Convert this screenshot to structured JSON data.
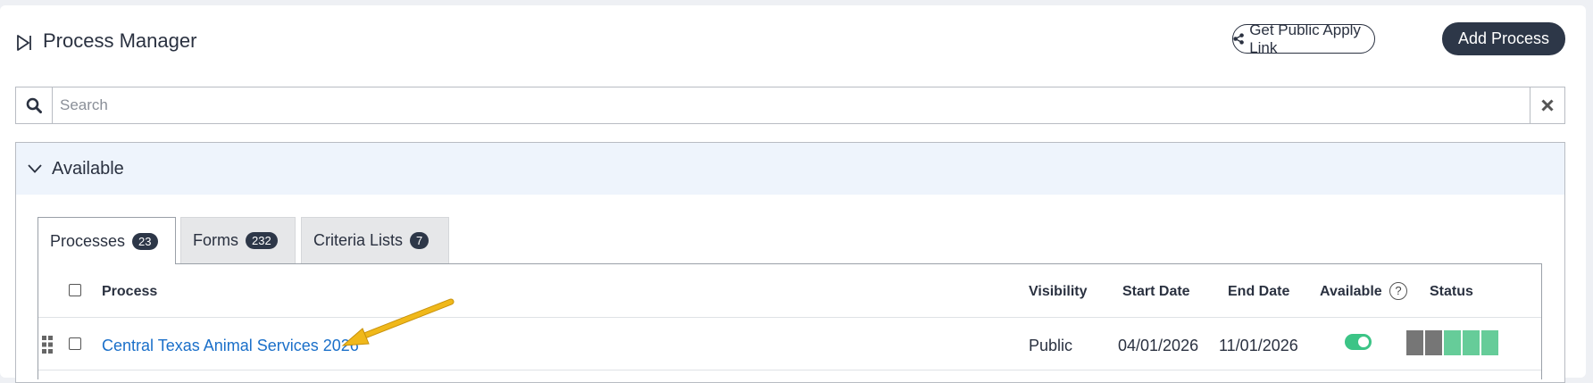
{
  "header": {
    "title": "Process Manager",
    "public_link_label": "Get Public Apply Link",
    "add_process_label": "Add Process"
  },
  "search": {
    "placeholder": "Search",
    "value": ""
  },
  "panel": {
    "title": "Available",
    "expanded": true
  },
  "tabs": [
    {
      "label": "Processes",
      "count": "23",
      "active": true
    },
    {
      "label": "Forms",
      "count": "232",
      "active": false
    },
    {
      "label": "Criteria Lists",
      "count": "7",
      "active": false
    }
  ],
  "table": {
    "columns": [
      "Process",
      "Visibility",
      "Start Date",
      "End Date",
      "Available",
      "Status"
    ],
    "rows": [
      {
        "process": "Central Texas Animal Services 2026",
        "visibility": "Public",
        "start_date": "04/01/2026",
        "end_date": "11/01/2026",
        "available": true,
        "status_segments": [
          "gray",
          "gray",
          "green",
          "green",
          "green"
        ]
      }
    ]
  },
  "colors": {
    "primary_dark": "#2d3748",
    "link": "#1a6fc9",
    "toggle_on": "#3cc486",
    "status_gray": "#767676",
    "status_green": "#66cc99",
    "annotation_arrow": "#f0b81a"
  }
}
